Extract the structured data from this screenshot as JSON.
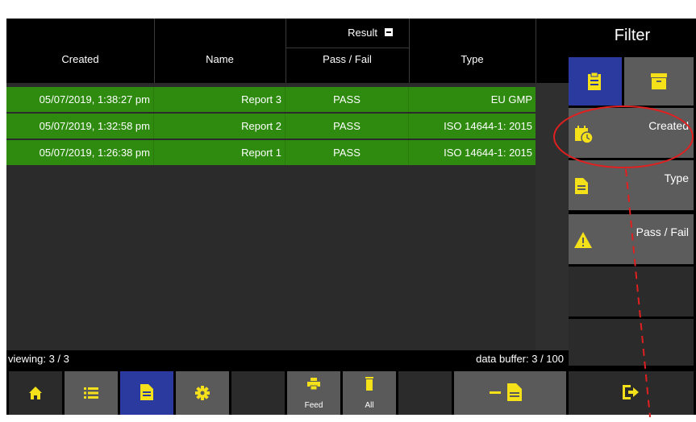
{
  "table": {
    "headers": {
      "created": "Created",
      "name": "Name",
      "result": "Result",
      "pass_fail": "Pass / Fail",
      "type": "Type"
    },
    "rows": [
      {
        "created": "05/07/2019, 1:38:27 pm",
        "name": "Report 3",
        "result": "PASS",
        "type": "EU GMP"
      },
      {
        "created": "05/07/2019, 1:32:58 pm",
        "name": "Report 2",
        "result": "PASS",
        "type": "ISO 14644-1: 2015"
      },
      {
        "created": "05/07/2019, 1:26:38 pm",
        "name": "Report 1",
        "result": "PASS",
        "type": "ISO 14644-1: 2015"
      }
    ]
  },
  "status": {
    "viewing": "viewing: 3 / 3",
    "data_buffer": "data buffer: 3 / 100"
  },
  "toolbar": {
    "items": [
      {
        "name": "home",
        "icon": "home-icon"
      },
      {
        "name": "list",
        "icon": "list-icon"
      },
      {
        "name": "reports",
        "icon": "document-icon",
        "active": true
      },
      {
        "name": "settings",
        "icon": "gear-icon"
      },
      {
        "name": "feed",
        "icon": "printer-icon",
        "label": "Feed"
      },
      {
        "name": "delete-all",
        "icon": "trash-icon",
        "label": "All"
      },
      {
        "name": "remove-report",
        "icon": "minus-document-icon"
      }
    ]
  },
  "sidebar": {
    "title": "Filter",
    "filters": [
      {
        "label": "Created",
        "icon": "calendar-clock-icon"
      },
      {
        "label": "Type",
        "icon": "document-icon"
      },
      {
        "label": "Pass / Fail",
        "icon": "warning-icon"
      }
    ],
    "exit_icon": "exit-icon"
  },
  "colors": {
    "row_green": "#2e8b0f",
    "active_blue": "#2b3a9e",
    "icon_yellow": "#f5e11a",
    "annotation_red": "#e02020"
  }
}
